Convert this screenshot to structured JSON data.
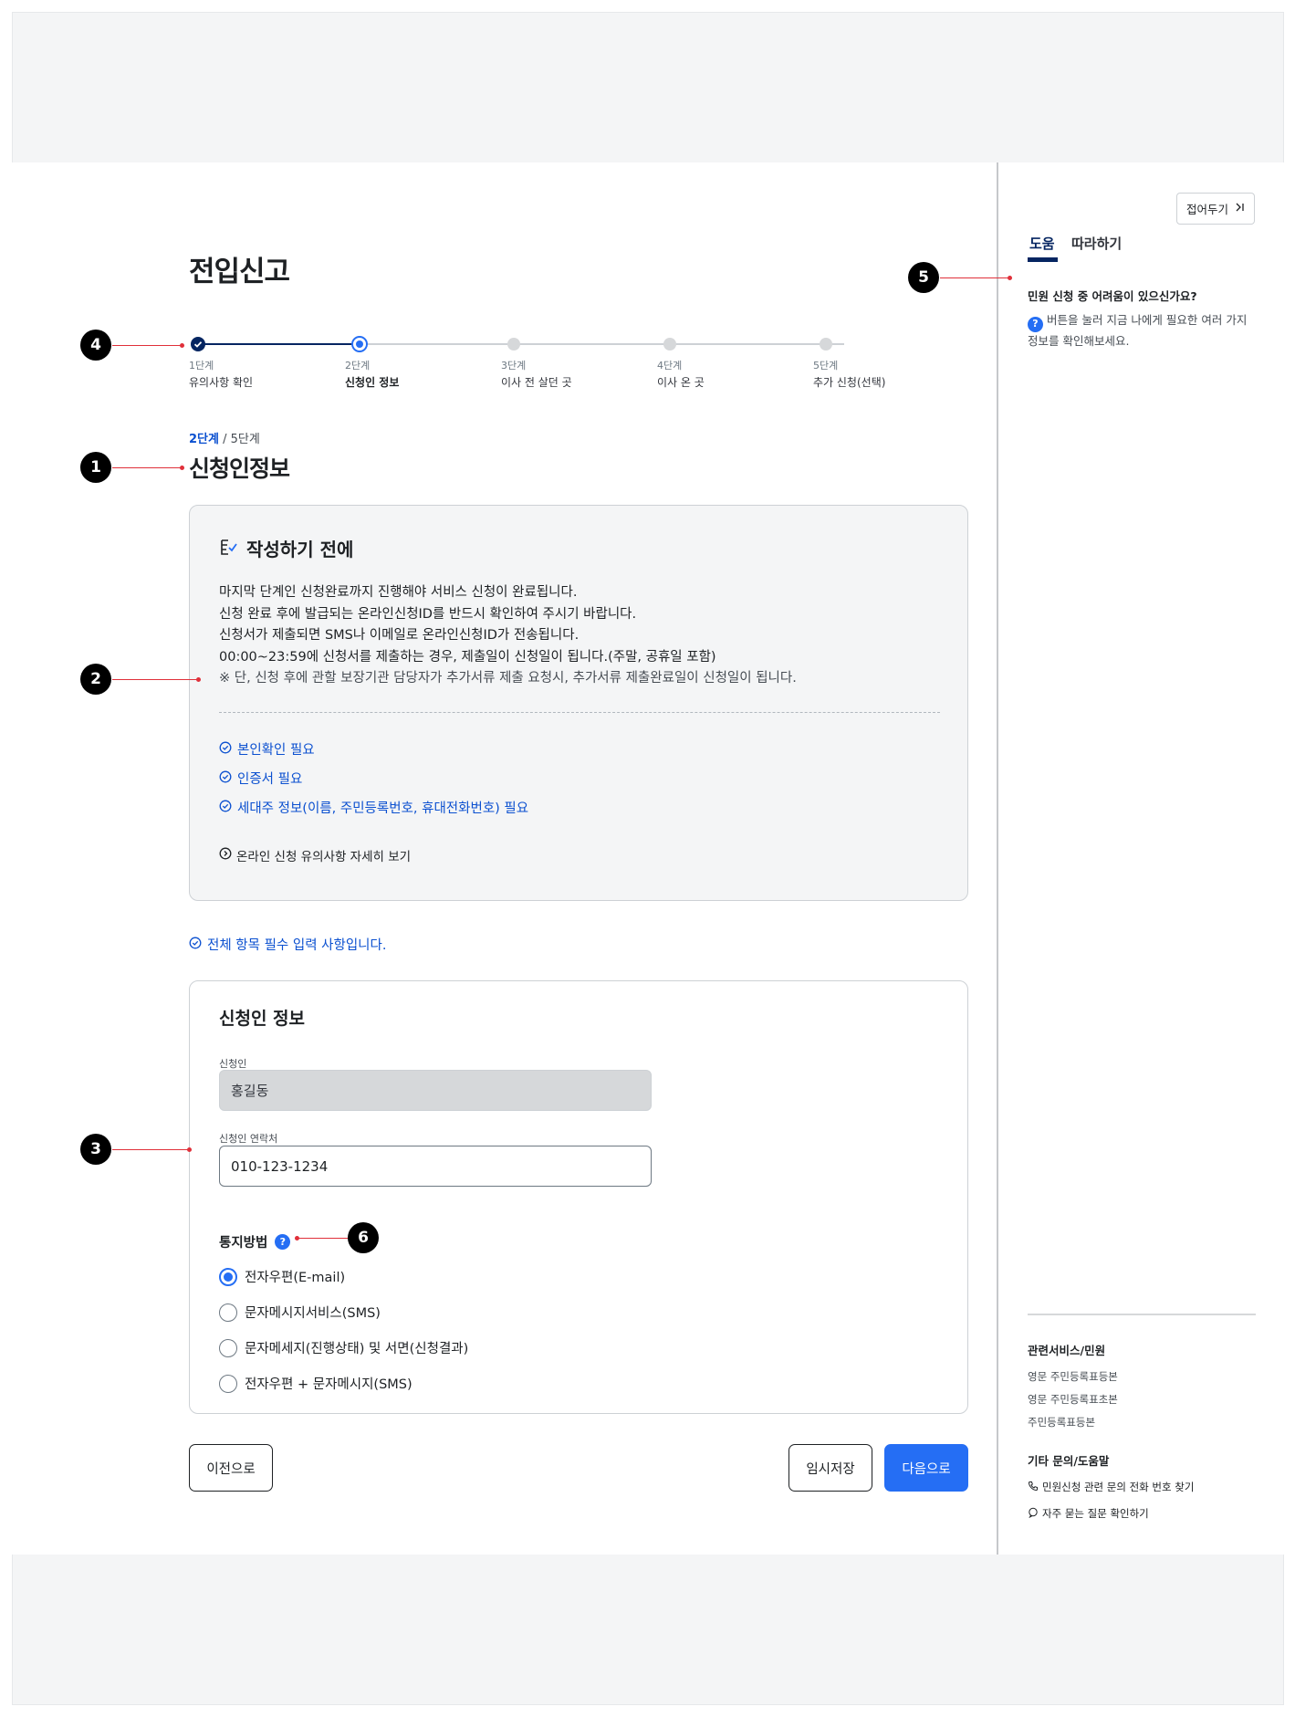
{
  "page": {
    "title": "전입신고"
  },
  "stepper": {
    "steps": [
      {
        "num": "1단계",
        "name": "유의사항 확인"
      },
      {
        "num": "2단계",
        "name": "신청인 정보"
      },
      {
        "num": "3단계",
        "name": "이사 전 살던 곳"
      },
      {
        "num": "4단계",
        "name": "이사 온 곳"
      },
      {
        "num": "5단계",
        "name": "추가 신청(선택)"
      }
    ],
    "current": "2단계",
    "total": "/ 5단계"
  },
  "section": {
    "title": "신청인정보"
  },
  "notice": {
    "title": "작성하기 전에",
    "lines": [
      "마지막 단계인 신청완료까지 진행해야 서비스 신청이 완료됩니다.",
      "신청 완료 후에 발급되는 온라인신청ID를 반드시 확인하여 주시기 바랍니다.",
      "신청서가 제출되면 SMS나 이메일로 온라인신청ID가 전송됩니다.",
      "00:00~23:59에 신청서를 제출하는 경우, 제출일이 신청일이 됩니다.(주말, 공휴일 포함)"
    ],
    "note": "※ 단, 신청 후에 관할 보장기관 담당자가 추가서류 제출 요청시, 추가서류 제출완료일이 신청일이 됩니다.",
    "requirements": [
      "본인확인 필요",
      "인증서 필요",
      "세대주 정보(이름, 주민등록번호, 휴대전화번호) 필요"
    ],
    "more_link": "온라인 신청 유의사항 자세히 보기"
  },
  "required_note": "전체 항목 필수 입력 사항입니다.",
  "form": {
    "title": "신청인 정보",
    "applicant_label": "신청인",
    "applicant_value": "홍길동",
    "contact_label": "신청인 연락처",
    "contact_value": "010-123-1234",
    "notification_label": "통지방법",
    "notification_options": [
      "전자우편(E-mail)",
      "문자메시지서비스(SMS)",
      "문자메세지(진행상태) 및 서면(신청결과)",
      "전자우편 + 문자메시지(SMS)"
    ],
    "notification_selected": "전자우편(E-mail)"
  },
  "buttons": {
    "prev": "이전으로",
    "save": "임시저장",
    "next": "다음으로"
  },
  "sidebar": {
    "collapse": "접어두기",
    "tabs": [
      "도움",
      "따라하기"
    ],
    "active_tab": "도움",
    "question": "민원 신청 중 어려움이 있으신가요?",
    "description": "버튼을 눌러 지금 나에게 필요한 여러 가지 정보를 확인해보세요.",
    "related_title": "관련서비스/민원",
    "related_links": [
      "영문 주민등록표등본",
      "영문 주민등록표초본",
      "주민등록표등본"
    ],
    "other_title": "기타 문의/도움말",
    "other_links": [
      "민원신청 관련 문의 전화 번호 찾기",
      "자주 묻는 질문 확인하기"
    ]
  },
  "annotations": [
    "1",
    "2",
    "3",
    "4",
    "5",
    "6"
  ],
  "colors": {
    "primary": "#256ef4",
    "link": "#0b50d0",
    "navy": "#052561",
    "annotation": "#e0303a"
  }
}
